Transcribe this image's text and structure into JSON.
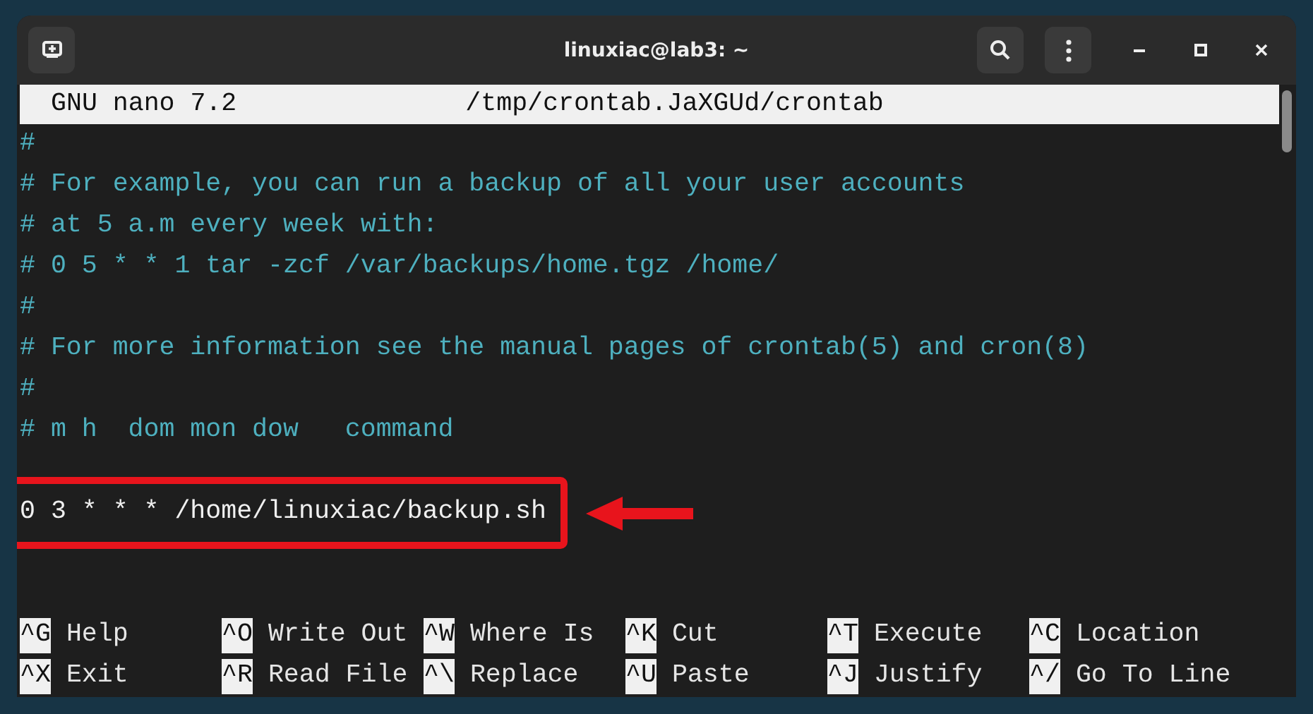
{
  "window": {
    "title": "linuxiac@lab3: ~"
  },
  "editor": {
    "app": "GNU nano 7.2",
    "file": "/tmp/crontab.JaXGUd/crontab",
    "lines": [
      {
        "kind": "comment",
        "text": "#"
      },
      {
        "kind": "comment",
        "text": "# For example, you can run a backup of all your user accounts"
      },
      {
        "kind": "comment",
        "text": "# at 5 a.m every week with:"
      },
      {
        "kind": "comment",
        "text": "# 0 5 * * 1 tar -zcf /var/backups/home.tgz /home/"
      },
      {
        "kind": "comment",
        "text": "#"
      },
      {
        "kind": "comment",
        "text": "# For more information see the manual pages of crontab(5) and cron(8)"
      },
      {
        "kind": "comment",
        "text": "#"
      },
      {
        "kind": "comment",
        "text": "# m h  dom mon dow   command"
      },
      {
        "kind": "blank"
      },
      {
        "kind": "command",
        "text": "0 3 * * * /home/linuxiac/backup.sh",
        "highlighted": true
      },
      {
        "kind": "blank"
      },
      {
        "kind": "blank"
      }
    ],
    "shortcuts": [
      {
        "key": "^G",
        "label": "Help"
      },
      {
        "key": "^O",
        "label": "Write Out"
      },
      {
        "key": "^W",
        "label": "Where Is"
      },
      {
        "key": "^K",
        "label": "Cut"
      },
      {
        "key": "^T",
        "label": "Execute"
      },
      {
        "key": "^C",
        "label": "Location"
      },
      {
        "key": "^X",
        "label": "Exit"
      },
      {
        "key": "^R",
        "label": "Read File"
      },
      {
        "key": "^\\",
        "label": "Replace"
      },
      {
        "key": "^U",
        "label": "Paste"
      },
      {
        "key": "^J",
        "label": "Justify"
      },
      {
        "key": "^/",
        "label": "Go To Line"
      }
    ]
  }
}
